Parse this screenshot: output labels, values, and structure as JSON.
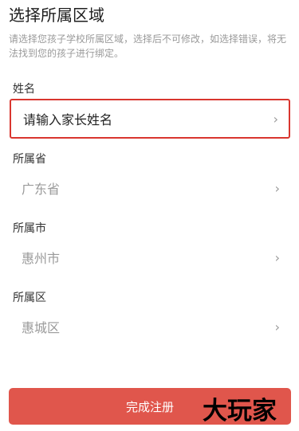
{
  "page": {
    "title": "选择所属区域",
    "subtitle": "请选择您孩子学校所属区域，选择后不可修改，如选择错误，将无法找到您的孩子进行绑定。"
  },
  "fields": [
    {
      "label": "姓名",
      "value": "请输入家长姓名"
    },
    {
      "label": "所属省",
      "value": "广东省"
    },
    {
      "label": "所属市",
      "value": "惠州市"
    },
    {
      "label": "所属区",
      "value": "惠城区"
    }
  ],
  "icons": {
    "row_arrow": "chevron-right-icon",
    "chevron_glyph": "›"
  },
  "submit": {
    "label": "完成注册"
  },
  "watermark": {
    "text": "大玩家"
  },
  "colors": {
    "submit_bg": "#e0564c",
    "highlight_border": "#d9362f"
  }
}
